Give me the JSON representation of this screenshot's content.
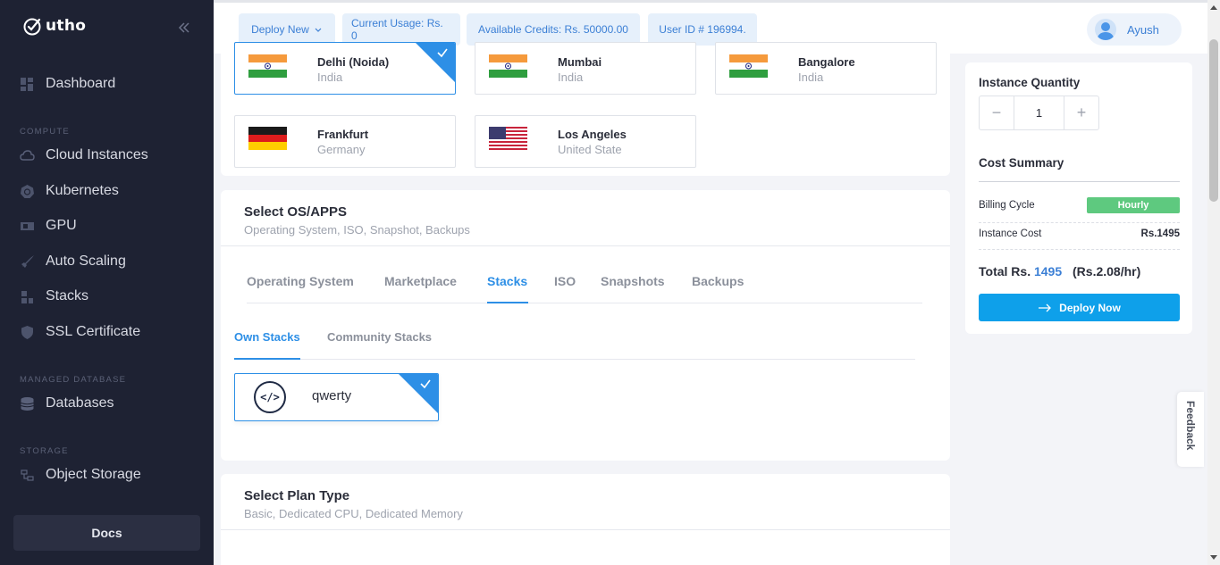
{
  "brand": {
    "name": "utho"
  },
  "sidebar": {
    "dashboard": "Dashboard",
    "compute_label": "COMPUTE",
    "compute_items": [
      "Cloud Instances",
      "Kubernetes",
      "GPU",
      "Auto Scaling",
      "Stacks",
      "SSL Certificate"
    ],
    "managed_db_label": "MANAGED DATABASE",
    "databases": "Databases",
    "storage_label": "STORAGE",
    "object_storage": "Object Storage",
    "docs": "Docs"
  },
  "topbar": {
    "deploy_new": "Deploy New",
    "current_usage": "Current Usage: Rs. 0",
    "available_credits": "Available Credits: Rs. 50000.00",
    "user_id": "User ID # 196994.",
    "user_name": "Ayush"
  },
  "locations": [
    {
      "city": "Delhi (Noida)",
      "country": "India",
      "selected": true,
      "flag": "india"
    },
    {
      "city": "Mumbai",
      "country": "India",
      "selected": false,
      "flag": "india"
    },
    {
      "city": "Bangalore",
      "country": "India",
      "selected": false,
      "flag": "india"
    },
    {
      "city": "Frankfurt",
      "country": "Germany",
      "selected": false,
      "flag": "germany"
    },
    {
      "city": "Los Angeles",
      "country": "United State",
      "selected": false,
      "flag": "usa"
    }
  ],
  "os_section": {
    "title": "Select OS/APPS",
    "subtitle": "Operating System, ISO, Snapshot, Backups",
    "tabs": [
      "Operating System",
      "Marketplace",
      "Stacks",
      "ISO",
      "Snapshots",
      "Backups"
    ],
    "active_tab": "Stacks",
    "subtabs": [
      "Own Stacks",
      "Community Stacks"
    ],
    "active_subtab": "Own Stacks",
    "stack": {
      "name": "qwerty",
      "icon": "code-icon"
    }
  },
  "plan_section": {
    "title": "Select Plan Type",
    "subtitle": "Basic, Dedicated CPU, Dedicated Memory"
  },
  "summary": {
    "quantity_title": "Instance Quantity",
    "quantity": "1",
    "minus": "−",
    "plus": "+",
    "cost_title": "Cost Summary",
    "billing_label": "Billing Cycle",
    "billing_value": "Hourly",
    "instance_cost_label": "Instance Cost",
    "instance_cost_value": "Rs.1495",
    "total_prefix": "Total Rs.",
    "total_amount": "1495",
    "total_hourly": "(Rs.2.08/hr)",
    "deploy_button": "Deploy Now"
  },
  "feedback": "Feedback",
  "colors": {
    "accent": "#2d8fe6",
    "sidebar": "#1e2233",
    "success": "#5ec97f",
    "deploy": "#0ea0ea"
  }
}
